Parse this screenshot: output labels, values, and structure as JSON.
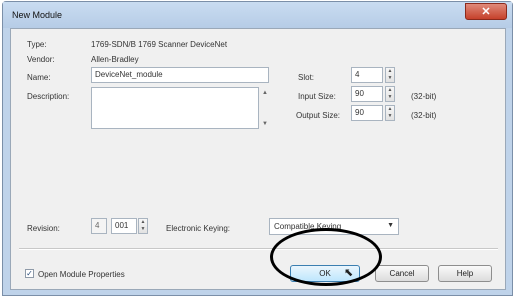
{
  "window": {
    "title": "New Module",
    "close_glyph": "✕"
  },
  "module": {
    "type_label": "Type:",
    "type_value": "1769-SDN/B 1769 Scanner DeviceNet",
    "vendor_label": "Vendor:",
    "vendor_value": "Allen-Bradley",
    "name_label": "Name:",
    "name_value": "DeviceNet_module",
    "description_label": "Description:",
    "description_value": ""
  },
  "params": {
    "slot_label": "Slot:",
    "slot_value": "4",
    "input_size_label": "Input Size:",
    "input_size_value": "90",
    "input_size_unit": "(32-bit)",
    "output_size_label": "Output Size:",
    "output_size_value": "90",
    "output_size_unit": "(32-bit)"
  },
  "revision": {
    "label": "Revision:",
    "major": "4",
    "minor": "001",
    "keying_label": "Electronic Keying:",
    "keying_value": "Compatible Keying"
  },
  "footer": {
    "open_props_label": "Open Module Properties",
    "open_props_checked": true,
    "ok_label": "OK",
    "cancel_label": "Cancel",
    "help_label": "Help"
  },
  "icons": {
    "spin_up": "▲",
    "spin_down": "▼",
    "dropdown": "▼",
    "check": "✓",
    "cursor": "⬉"
  }
}
